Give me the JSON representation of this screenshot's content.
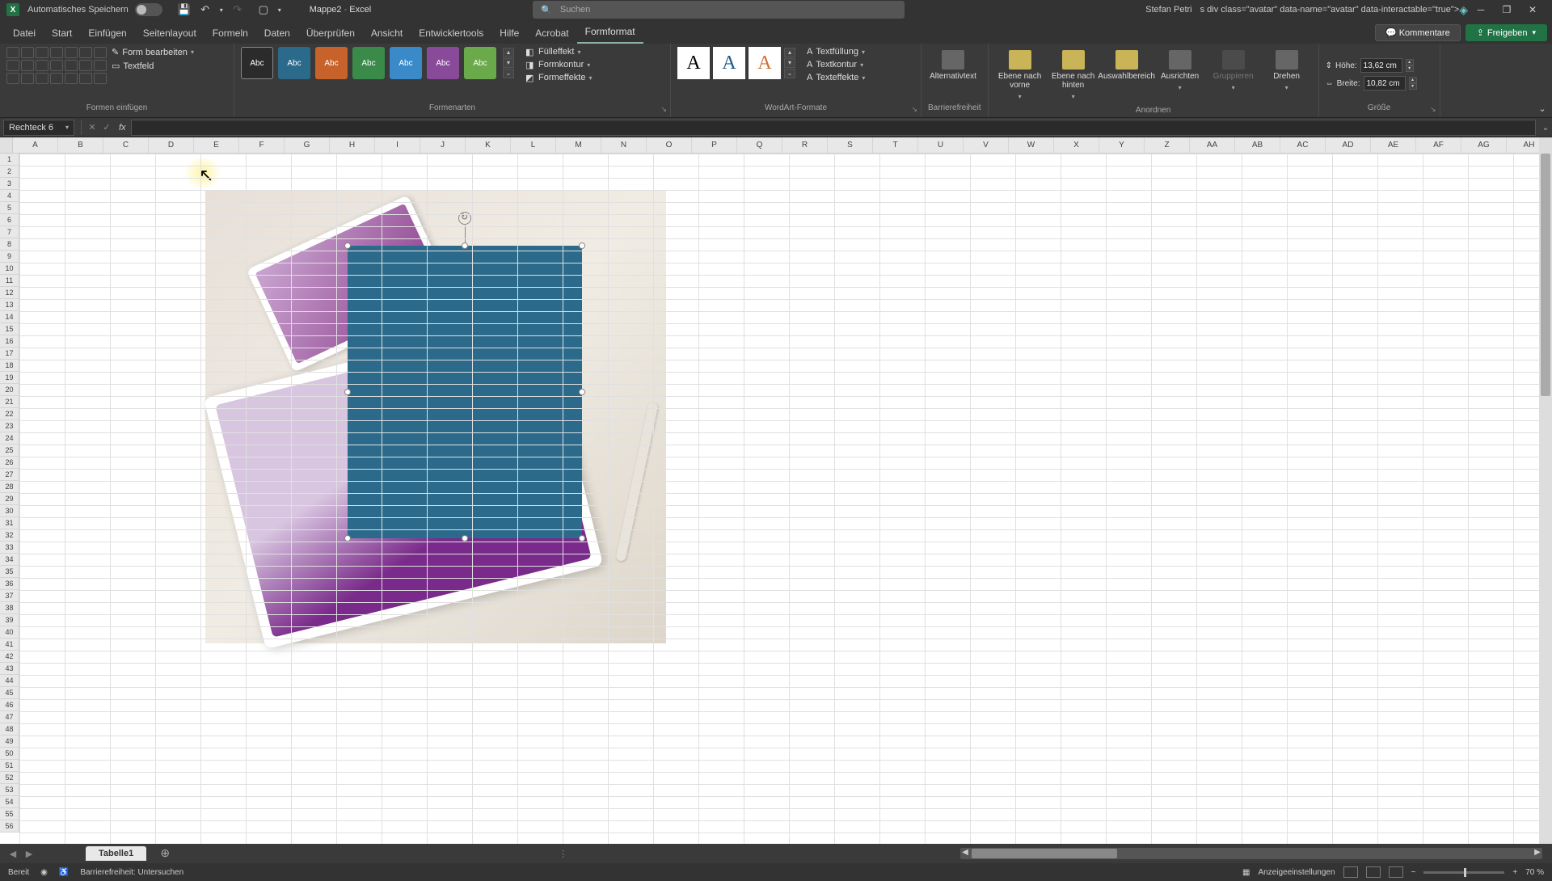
{
  "titlebar": {
    "autosave_label": "Automatisches Speichern",
    "doc_name": "Mappe2",
    "app_name": "Excel",
    "search_placeholder": "Suchen",
    "user_name": "Stefan Petri"
  },
  "tabs": {
    "datei": "Datei",
    "start": "Start",
    "einfuegen": "Einfügen",
    "seitenlayout": "Seitenlayout",
    "formeln": "Formeln",
    "daten": "Daten",
    "ueberpruefen": "Überprüfen",
    "ansicht": "Ansicht",
    "entwicklertools": "Entwicklertools",
    "hilfe": "Hilfe",
    "acrobat": "Acrobat",
    "formformat": "Formformat",
    "kommentare": "Kommentare",
    "freigeben": "Freigeben"
  },
  "ribbon": {
    "form_bearbeiten": "Form bearbeiten",
    "textfeld": "Textfeld",
    "group_formen_einfuegen": "Formen einfügen",
    "swatch_label": "Abc",
    "fuelleffekt": "Fülleffekt",
    "formkontur": "Formkontur",
    "formeffekte": "Formeffekte",
    "group_formenarten": "Formenarten",
    "wa_letter": "A",
    "textfuellung": "Textfüllung",
    "textkontur": "Textkontur",
    "texteffekte": "Texteffekte",
    "group_wordart": "WordArt-Formate",
    "alternativtext": "Alternativtext",
    "group_barrierefreiheit": "Barrierefreiheit",
    "ebene_vorne": "Ebene nach vorne",
    "ebene_hinten": "Ebene nach hinten",
    "auswahlbereich": "Auswahlbereich",
    "ausrichten": "Ausrichten",
    "gruppieren": "Gruppieren",
    "drehen": "Drehen",
    "group_anordnen": "Anordnen",
    "hoehe_label": "Höhe:",
    "hoehe_value": "13,62 cm",
    "breite_label": "Breite:",
    "breite_value": "10,82 cm",
    "group_groesse": "Größe"
  },
  "formula": {
    "name_box": "Rechteck 6",
    "fx": "fx"
  },
  "columns": [
    "A",
    "B",
    "C",
    "D",
    "E",
    "F",
    "G",
    "H",
    "I",
    "J",
    "K",
    "L",
    "M",
    "N",
    "O",
    "P",
    "Q",
    "R",
    "S",
    "T",
    "U",
    "V",
    "W",
    "X",
    "Y",
    "Z",
    "AA",
    "AB",
    "AC",
    "AD",
    "AE",
    "AF",
    "AG",
    "AH"
  ],
  "rows_count": 56,
  "sheet": {
    "tab1": "Tabelle1"
  },
  "status": {
    "bereit": "Bereit",
    "barrierefreiheit": "Barrierefreiheit: Untersuchen",
    "anzeige": "Anzeigeeinstellungen",
    "zoom": "70 %"
  }
}
